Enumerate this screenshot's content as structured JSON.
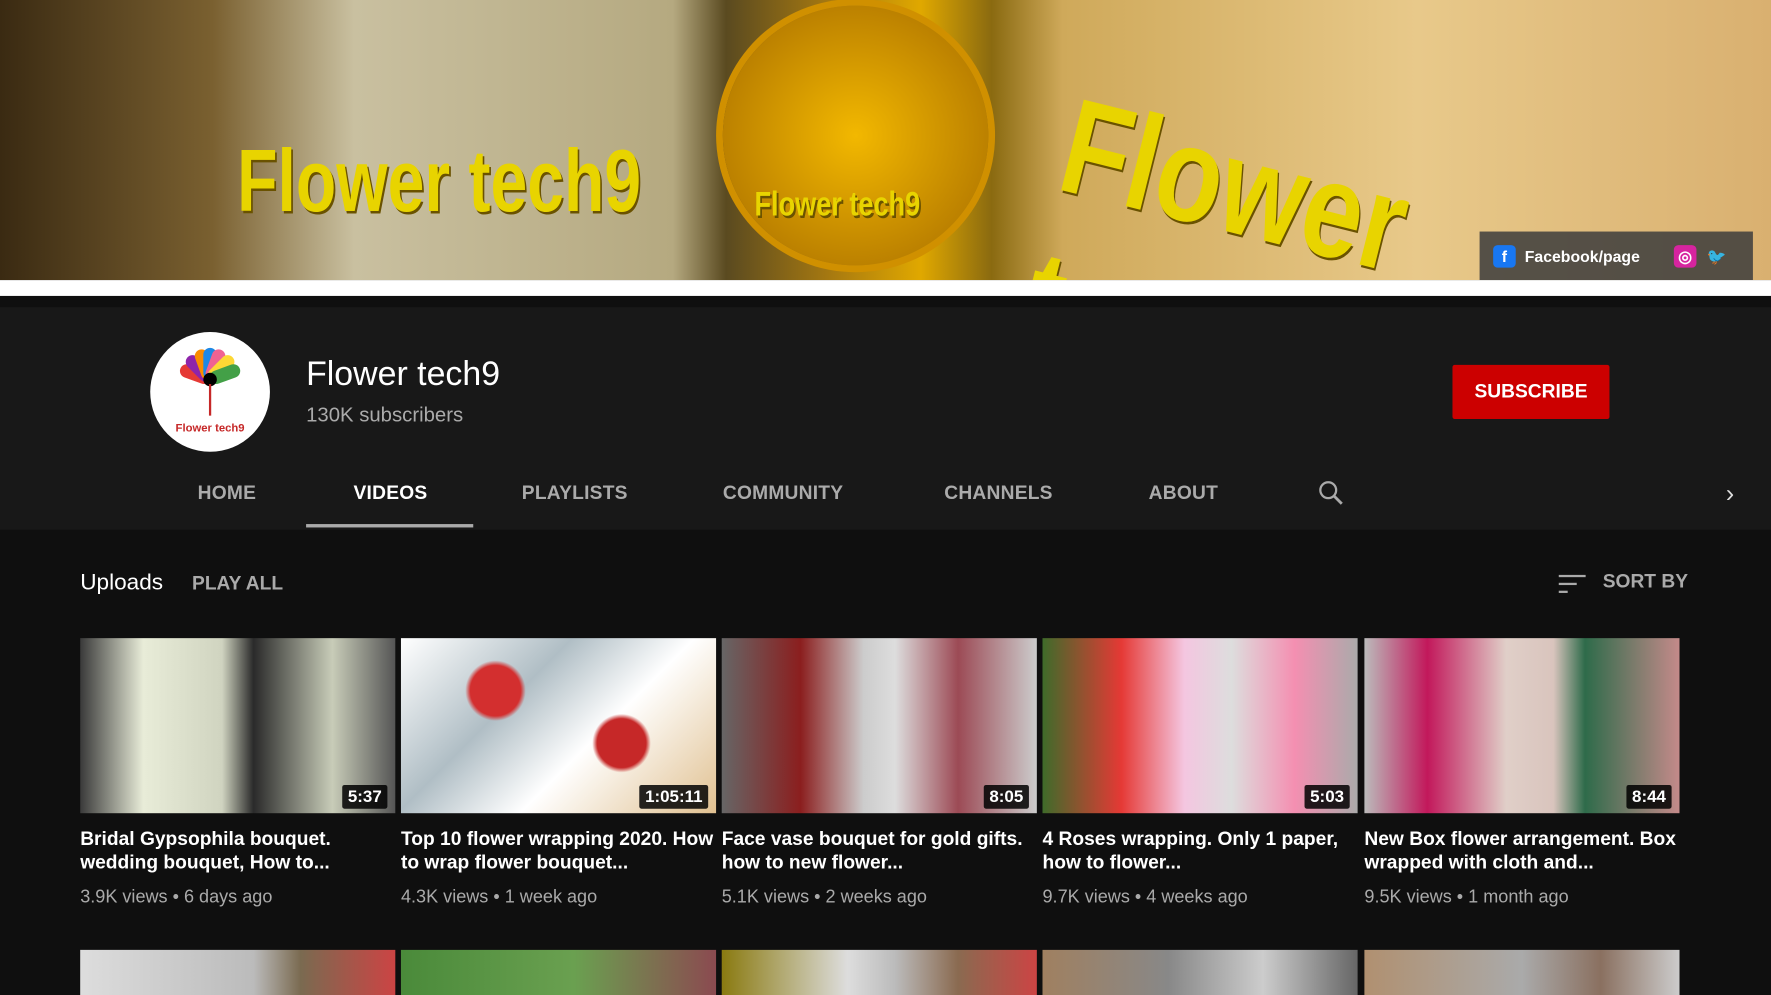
{
  "banner": {
    "brand_text": "Flower tech9",
    "social_label": "Facebook/page"
  },
  "channel": {
    "name": "Flower tech9",
    "subscribers": "130K subscribers",
    "subscribe_label": "SUBSCRIBE",
    "avatar_text": "Flower tech9"
  },
  "tabs": [
    {
      "label": "HOME"
    },
    {
      "label": "VIDEOS",
      "active": true
    },
    {
      "label": "PLAYLISTS"
    },
    {
      "label": "COMMUNITY"
    },
    {
      "label": "CHANNELS"
    },
    {
      "label": "ABOUT"
    }
  ],
  "section": {
    "title": "Uploads",
    "play_all": "PLAY ALL",
    "sort_by": "SORT BY"
  },
  "videos": [
    {
      "title": "Bridal Gypsophila bouquet. wedding bouquet, How to...",
      "duration": "5:37",
      "views": "3.9K views",
      "age": "6 days ago"
    },
    {
      "title": "Top 10 flower wrapping 2020. How to wrap flower bouquet...",
      "duration": "1:05:11",
      "views": "4.3K views",
      "age": "1 week ago"
    },
    {
      "title": "Face vase bouquet for gold gifts. how to new flower...",
      "duration": "8:05",
      "views": "5.1K views",
      "age": "2 weeks ago"
    },
    {
      "title": "4 Roses wrapping. Only 1 paper, how to flower...",
      "duration": "5:03",
      "views": "9.7K views",
      "age": "4 weeks ago"
    },
    {
      "title": "New Box flower arrangement. Box wrapped with cloth and...",
      "duration": "8:44",
      "views": "9.5K views",
      "age": "1 month ago"
    }
  ],
  "colors": {
    "subscribe": "#cc0000",
    "header_bg": "#181818",
    "page_bg": "#0f0f0f"
  }
}
